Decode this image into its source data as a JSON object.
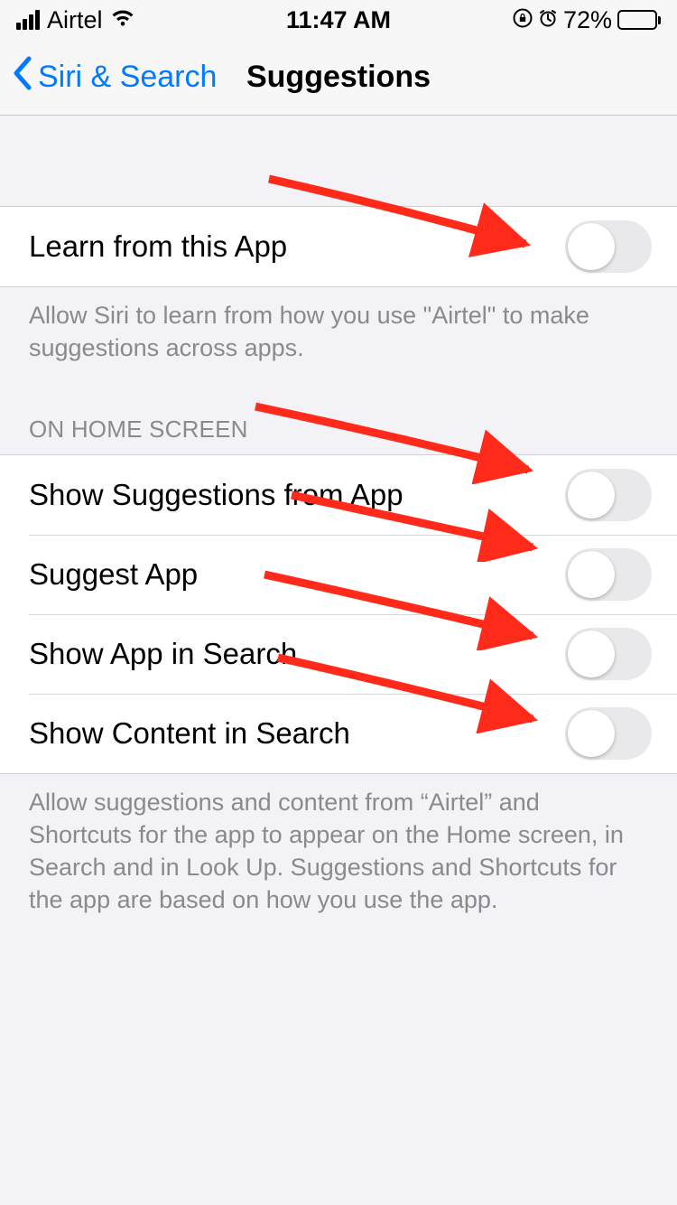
{
  "status": {
    "carrier": "Airtel",
    "time": "11:47 AM",
    "battery_pct": "72%"
  },
  "nav": {
    "back_label": "Siri & Search",
    "title": "Suggestions"
  },
  "section1": {
    "rows": [
      {
        "label": "Learn from this App"
      }
    ],
    "footer": "Allow Siri to learn from how you use \"Airtel\" to make suggestions across apps."
  },
  "section2": {
    "header": "ON HOME SCREEN",
    "rows": [
      {
        "label": "Show Suggestions from App"
      },
      {
        "label": "Suggest App"
      },
      {
        "label": "Show App in Search"
      },
      {
        "label": "Show Content in Search"
      }
    ],
    "footer": "Allow suggestions and content from “Airtel” and Shortcuts for the app to appear on the Home screen, in Search and in Look Up. Suggestions and Shortcuts for the app are based on how you use the app."
  }
}
